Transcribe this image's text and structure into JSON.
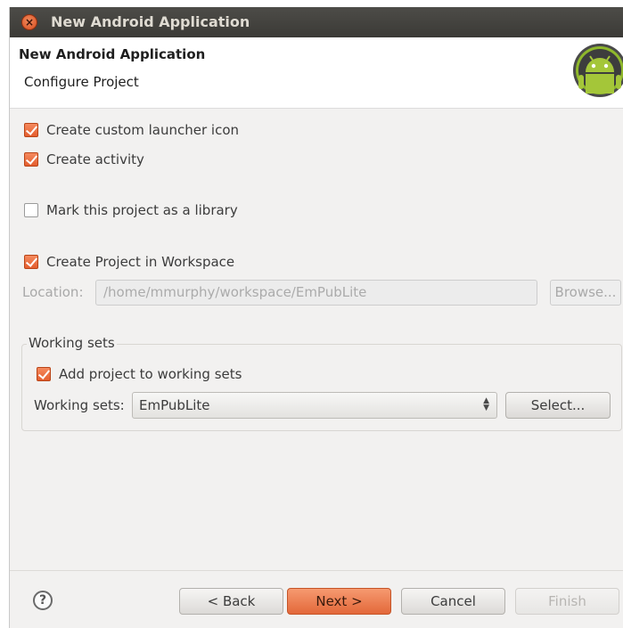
{
  "window": {
    "title": "New Android Application",
    "close_glyph": "×"
  },
  "header": {
    "title": "New Android Application",
    "subtitle": "Configure Project",
    "logo_icon": "android-logo"
  },
  "options": {
    "launcher_icon": {
      "label": "Create custom launcher icon",
      "checked": true
    },
    "activity": {
      "label": "Create activity",
      "checked": true
    },
    "library": {
      "label": "Mark this project as a library",
      "checked": false
    },
    "workspace": {
      "label": "Create Project in Workspace",
      "checked": true
    }
  },
  "location": {
    "label": "Location:",
    "value": "/home/mmurphy/workspace/EmPubLite",
    "browse_label": "Browse..."
  },
  "working_sets": {
    "legend": "Working sets",
    "add_label": "Add project to working sets",
    "add_checked": true,
    "field_label": "Working sets:",
    "selected": "EmPubLite",
    "select_label": "Select..."
  },
  "footer": {
    "help_glyph": "?",
    "back_label": "< Back",
    "next_label": "Next >",
    "cancel_label": "Cancel",
    "finish_label": "Finish"
  },
  "colors": {
    "accent": "#e4643a",
    "titlebar": "#3f3e3a",
    "android_green": "#a4c639"
  }
}
